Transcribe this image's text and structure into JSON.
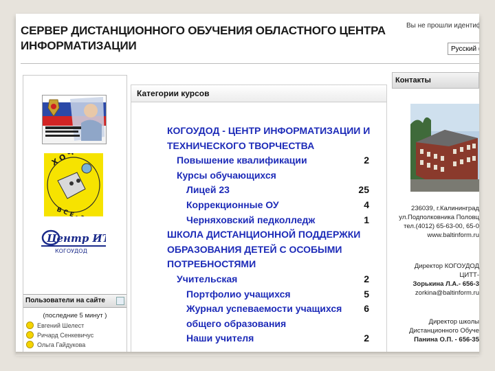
{
  "header": {
    "title_line1": "СЕРВЕР ДИСТАНЦИОННОГО ОБУЧЕНИЯ ОБЛАСТНОГО ЦЕНТРА",
    "title_line2": "ИНФОРМАТИЗАЦИИ",
    "login_info": "Вы не прошли идентиф",
    "language": "Русский (r"
  },
  "left": {
    "logo3_text": "Центр ИТТ",
    "logo3_sub": "КОГОУДОД",
    "users": {
      "title": "Пользователи на сайте",
      "subtitle": "(последние 5 минут )",
      "list": [
        "Евгений Шелест",
        "Ричард Сенкевичус",
        "Ольга Гайдукова"
      ]
    }
  },
  "categories": {
    "title": "Категории курсов",
    "items": [
      {
        "name": "КОГОУДОД - ЦЕНТР ИНФОРМАТИЗАЦИИ И",
        "count": ""
      },
      {
        "name": "ТЕХНИЧЕСКОГО ТВОРЧЕСТВА",
        "count": ""
      },
      {
        "name": "Повышение квалификации",
        "count": "2"
      },
      {
        "name": "Курсы обучающихся",
        "count": ""
      },
      {
        "name": "Лицей 23",
        "count": "25"
      },
      {
        "name": "Коррекционные ОУ",
        "count": "4"
      },
      {
        "name": "Черняховский педколледж",
        "count": "1"
      },
      {
        "name": "ШКОЛА ДИСТАНЦИОННОЙ ПОДДЕРЖКИ",
        "count": ""
      },
      {
        "name": "ОБРАЗОВАНИЯ ДЕТЕЙ С ОСОБЫМИ",
        "count": ""
      },
      {
        "name": "ПОТРЕБНОСТЯМИ",
        "count": ""
      },
      {
        "name": "Учительская",
        "count": "2"
      },
      {
        "name": "Портфолио учащихся",
        "count": "5"
      },
      {
        "name": "Журнал успеваемости учащихся",
        "count": "6"
      },
      {
        "name": "общего образования",
        "count": ""
      },
      {
        "name": "Наши учителя",
        "count": "2"
      }
    ]
  },
  "contacts": {
    "title": "Контакты",
    "address": [
      "236039, г.Калининград",
      "ул.Подполковника Половц",
      "тел.(4012) 65-63-00, 65-0",
      "www.baltinform.ru"
    ],
    "director1": [
      "Директор КОГОУДОД",
      "ЦИТТ-",
      "Зорькина Л.А.- 656-3",
      "zorkina@baltinform.ru"
    ],
    "director2": [
      "Директор школы",
      "Дистанционного Обуче",
      "Панина О.П. - 656-35"
    ]
  },
  "colors": {
    "link": "#1d2bb8",
    "slide_bg": "#e7e3dc"
  }
}
